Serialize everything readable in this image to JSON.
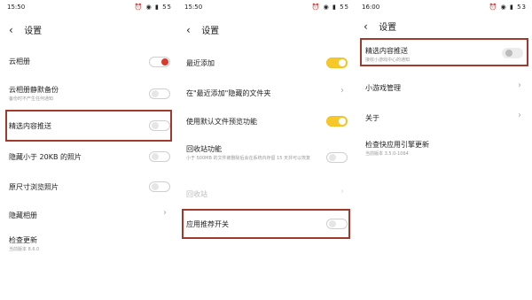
{
  "panel1": {
    "status_time": "15:50",
    "status_battery": "55",
    "title": "设置",
    "items": [
      {
        "label": "云相册"
      },
      {
        "label": "云相册静默备份",
        "sub": "备份时不产生任何通知"
      },
      {
        "label": "精选内容推送"
      },
      {
        "label": "隐藏小于 20KB 的照片"
      },
      {
        "label": "原尺寸浏览照片"
      },
      {
        "label": "隐藏相册"
      },
      {
        "label": "检查更新",
        "sub": "当前版本 8.6.0"
      }
    ]
  },
  "panel2": {
    "status_time": "15:50",
    "status_battery": "55",
    "title": "设置",
    "items": [
      {
        "label": "最近添加"
      },
      {
        "label": "在\"最近添加\"隐藏的文件夹"
      },
      {
        "label": "使用默认文件预览功能"
      },
      {
        "label": "回收站功能",
        "sub": "小于 500MB 的文件被删除后会在系统内存留 15 天并可以恢复"
      },
      {
        "label": "回收站"
      },
      {
        "label": "应用推荐开关"
      }
    ]
  },
  "panel3": {
    "status_time": "16:00",
    "status_battery": "53",
    "title": "设置",
    "items": [
      {
        "label": "精选内容推送",
        "sub": "接收小游戏中心的通知"
      },
      {
        "label": "小游戏管理"
      },
      {
        "label": "关于"
      },
      {
        "label": "检查快应用引擎更新",
        "sub": "当前版本 3.5.0-1064"
      }
    ]
  },
  "colors": {
    "red_toggle": "#d93a2e",
    "yellow_toggle": "#f7c82a",
    "highlight_box": "#a13a2c"
  }
}
